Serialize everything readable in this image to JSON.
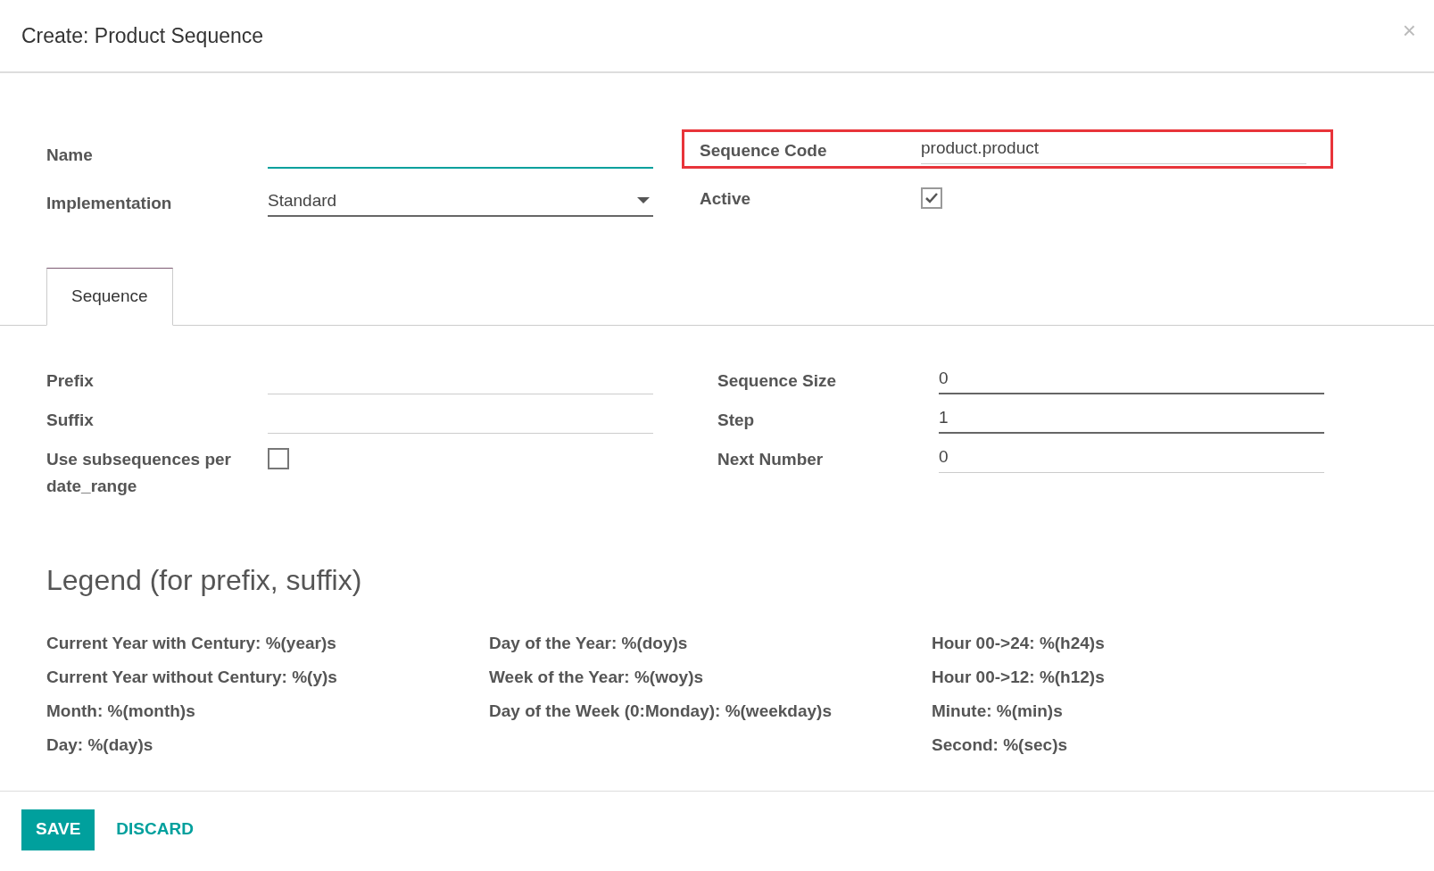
{
  "dialog": {
    "title": "Create: Product Sequence",
    "close": "×"
  },
  "header_fields": {
    "left": [
      {
        "label": "Name",
        "kind": "text",
        "required": false,
        "focused": true,
        "highlighted": false
      },
      {
        "label": "Implementation",
        "kind": "select",
        "value": "Standard",
        "required": true,
        "focused": false,
        "highlighted": false
      }
    ],
    "right": [
      {
        "label": "Sequence Code",
        "kind": "text",
        "value": "product.product",
        "required": false,
        "focused": false,
        "highlighted": true
      },
      {
        "label": "Active",
        "kind": "checkbox",
        "checked": true,
        "highlighted": false
      }
    ]
  },
  "tabs": [
    {
      "label": "Sequence",
      "selected": true
    }
  ],
  "sequence_fields": {
    "left": [
      {
        "label": "Prefix",
        "kind": "text",
        "required": false,
        "focused": false
      },
      {
        "label": "Suffix",
        "kind": "text",
        "required": false,
        "focused": false
      },
      {
        "label": "Use subsequences per date_range",
        "kind": "checkbox",
        "checked": false
      }
    ],
    "right": [
      {
        "label": "Sequence Size",
        "kind": "text",
        "value": "0",
        "required": true,
        "focused": false
      },
      {
        "label": "Step",
        "kind": "text",
        "value": "1",
        "required": true,
        "focused": false
      },
      {
        "label": "Next Number",
        "kind": "text",
        "value": "0",
        "required": false,
        "focused": false
      }
    ]
  },
  "legend": {
    "title": "Legend (for prefix, suffix)",
    "columns": [
      [
        "Current Year with Century: %(year)s",
        "Current Year without Century: %(y)s",
        "Month: %(month)s",
        "Day: %(day)s"
      ],
      [
        "Day of the Year: %(doy)s",
        "Week of the Year: %(woy)s",
        "Day of the Week (0:Monday): %(weekday)s"
      ],
      [
        "Hour 00->24: %(h24)s",
        "Hour 00->12: %(h12)s",
        "Minute: %(min)s",
        "Second: %(sec)s"
      ]
    ]
  },
  "footer": {
    "buttons": [
      {
        "label": "SAVE",
        "kind": "primary"
      },
      {
        "label": "DISCARD",
        "kind": "link"
      }
    ]
  }
}
